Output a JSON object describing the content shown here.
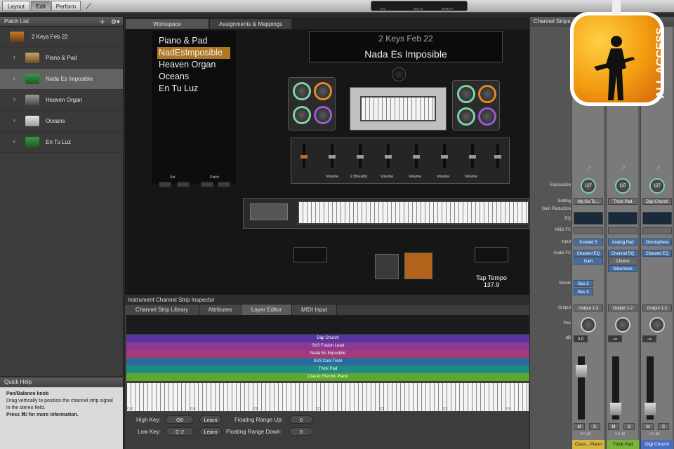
{
  "toolbar": {
    "modes": [
      "Layout",
      "Edit",
      "Perform"
    ],
    "active": "Edit",
    "meter": {
      "cpu": "CPU",
      "midi": "MIDI IN",
      "memory": "MEMORY"
    }
  },
  "patch_list": {
    "title": "Patch List",
    "set_name": "2 Keys Feb 22",
    "selected_index": 1,
    "items": [
      {
        "num": "1",
        "label": "Piano & Pad"
      },
      {
        "num": "2",
        "label": "Nada Es Imposible"
      },
      {
        "num": "3",
        "label": "Heaven Organ"
      },
      {
        "num": "4",
        "label": "Oceans"
      },
      {
        "num": "5",
        "label": "En Tu Luz"
      }
    ]
  },
  "quick_help": {
    "title": "Quick Help",
    "heading": "Pan/Balance knob",
    "body": "Drag vertically to position the channel strip signal in the stereo field.",
    "more": "Press ⌘/ for more information."
  },
  "workspace": {
    "tabs": [
      "Workspace",
      "Assignments & Mappings"
    ],
    "setlist": [
      "Piano & Pad",
      "NadEsImposible",
      "Heaven Organ",
      "Oceans",
      "En Tu Luz"
    ],
    "setlist_highlight": 1,
    "display_title": "2 Keys Feb 22",
    "display_patch": "Nada Es Imposible",
    "fader_labels": [
      "Volume",
      "2 (Breath)",
      "Volume",
      "Volume",
      "Volume",
      "Volume"
    ],
    "set_label": "Set",
    "patch_label": "Patch",
    "tap_tempo_label": "Tap Tempo",
    "tempo": "137.9"
  },
  "inspector": {
    "title": "Instrument Channel Strip Inspector",
    "tabs": [
      "Channel Strip Library",
      "Attributes",
      "Layer Editor",
      "MIDI Input"
    ],
    "active_tab": "Layer Editor",
    "layers": [
      {
        "name": "Digi Church",
        "color": "#5a35a0"
      },
      {
        "name": "SV3 Fusion Lead",
        "color": "#8a3a95"
      },
      {
        "name": "Nada Es Imposible",
        "color": "#a33a7b"
      },
      {
        "name": "SV3 Cool Trem",
        "color": "#2c6a9e"
      },
      {
        "name": "Thick Pad",
        "color": "#1f8b83"
      },
      {
        "name": "Classic Electric Piano",
        "color": "#5ea82e"
      }
    ],
    "octaves": [
      "C-2",
      "C-1",
      "C0",
      "C1",
      "C2",
      "C3",
      "C4"
    ],
    "high_key_label": "High Key:",
    "high_key": "G8",
    "low_key_label": "Low Key:",
    "low_key": "C-2",
    "learn": "Learn",
    "float_up_label": "Floating Range Up:",
    "float_up": "0",
    "float_down_label": "Floating Range Down:",
    "float_down": "0"
  },
  "channel_strips": {
    "title": "Channel Strips",
    "row_labels": [
      "Expression",
      "Setting",
      "Gain Reduction",
      "EQ",
      "MIDI FX",
      "Input",
      "Audio FX",
      "Sends",
      "Output",
      "Pan",
      "dB"
    ],
    "strips": [
      {
        "expr": "127",
        "setting": "My Go To...",
        "input": "Kontakt 5",
        "fx": [
          "Channel EQ",
          "Gain"
        ],
        "sends": [
          "Bus 2",
          "Bus 5"
        ],
        "output": "Output 1-2",
        "db": "0.0",
        "peak": "0.0 dB",
        "name": "Class...Piano",
        "name_color": "#d7b640"
      },
      {
        "expr": "127",
        "setting": "Thick Pad",
        "input": "Analog Pad",
        "fx": [
          "Channel EQ",
          "Chorus",
          "SilverVerb"
        ],
        "sends": [],
        "output": "Output 1-2",
        "db": "-∞",
        "peak": "0.0 dB",
        "name": "Thick Pad",
        "name_color": "#79b538"
      },
      {
        "expr": "127",
        "setting": "Digi Church",
        "input": "Omnisphere",
        "fx": [
          "Channel EQ"
        ],
        "sends": [],
        "output": "Output 1-2",
        "db": "-∞",
        "peak": "0.0 dB",
        "name": "Digi Church",
        "name_color": "#4a6fc2"
      }
    ],
    "mute": "M",
    "solo": "S"
  },
  "badge": {
    "text": "ALL ACCESS"
  }
}
